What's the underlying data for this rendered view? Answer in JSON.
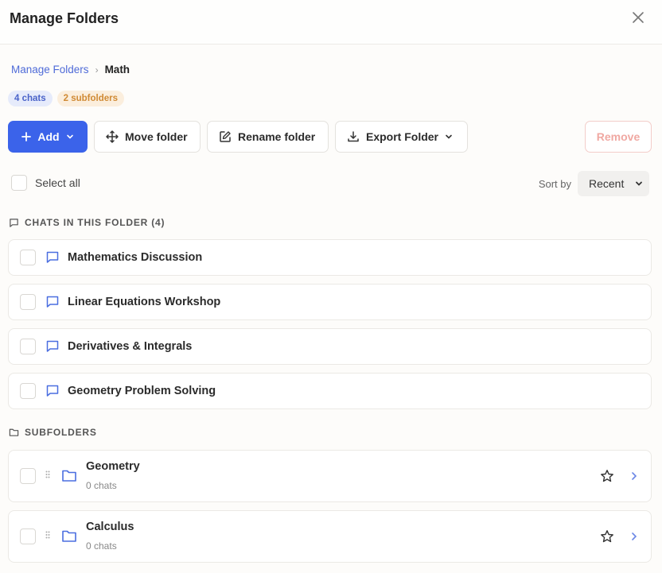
{
  "header": {
    "title": "Manage Folders"
  },
  "breadcrumb": {
    "root": "Manage Folders",
    "separator": "›",
    "current": "Math"
  },
  "badges": {
    "chats": "4 chats",
    "subfolders": "2 subfolders"
  },
  "toolbar": {
    "add_label": "Add",
    "move_label": "Move folder",
    "rename_label": "Rename folder",
    "export_label": "Export Folder",
    "remove_label": "Remove"
  },
  "select_all_label": "Select all",
  "sort": {
    "label": "Sort by",
    "value": "Recent"
  },
  "chats_section": {
    "title": "CHATS IN THIS FOLDER (4)",
    "items": [
      {
        "label": "Mathematics Discussion"
      },
      {
        "label": "Linear Equations Workshop"
      },
      {
        "label": "Derivatives & Integrals"
      },
      {
        "label": "Geometry Problem Solving"
      }
    ]
  },
  "subfolders_section": {
    "title": "SUBFOLDERS",
    "items": [
      {
        "name": "Geometry",
        "count": "0 chats"
      },
      {
        "name": "Calculus",
        "count": "0 chats"
      }
    ]
  },
  "colors": {
    "accent": "#3b63ea",
    "link": "#4f6bd8",
    "remove": "#f0a8a2"
  },
  "icons": [
    "close-icon",
    "plus-icon",
    "chevron-down-icon",
    "move-icon",
    "edit-icon",
    "download-icon",
    "chat-bubble-icon",
    "folder-icon",
    "drag-handle-icon",
    "star-icon",
    "chevron-right-icon"
  ]
}
